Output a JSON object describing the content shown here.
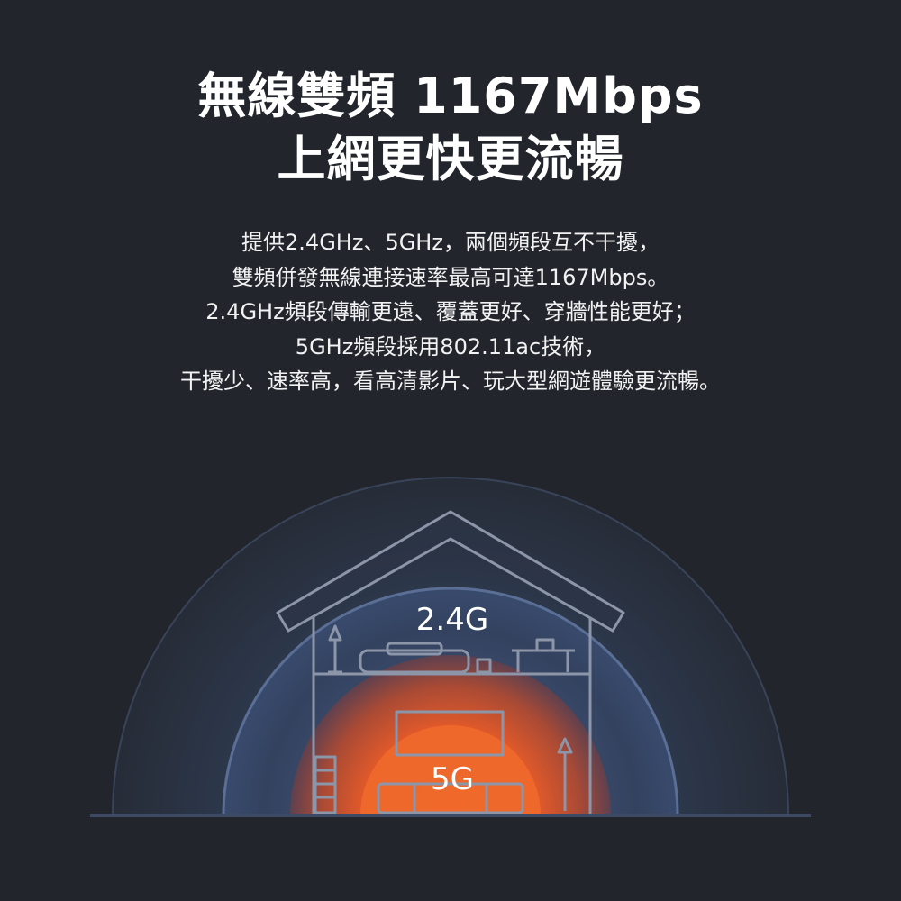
{
  "headline": {
    "line1": "無線雙頻 1167Mbps",
    "line2": "上網更快更流暢"
  },
  "description": {
    "lines": [
      "提供2.4GHz、5GHz，兩個頻段互不干擾，",
      "雙頻併發無線連接速率最高可達1167Mbps。",
      "2.4GHz頻段傳輸更遠、覆蓋更好、穿牆性能更好；",
      "5GHz頻段採用802.11ac技術，",
      "干擾少、速率高，看高清影片、玩大型網遊體驗更流暢。"
    ]
  },
  "illustration": {
    "band_24g_label": "2.4G",
    "band_5g_label": "5G",
    "colors": {
      "background": "#22262c",
      "outer_blue": "#2f3a52",
      "inner_blue": "#3a4c70",
      "orange_core": "#e8602a",
      "orange_glow": "#b8472a",
      "house_line": "#8c96a8"
    }
  }
}
